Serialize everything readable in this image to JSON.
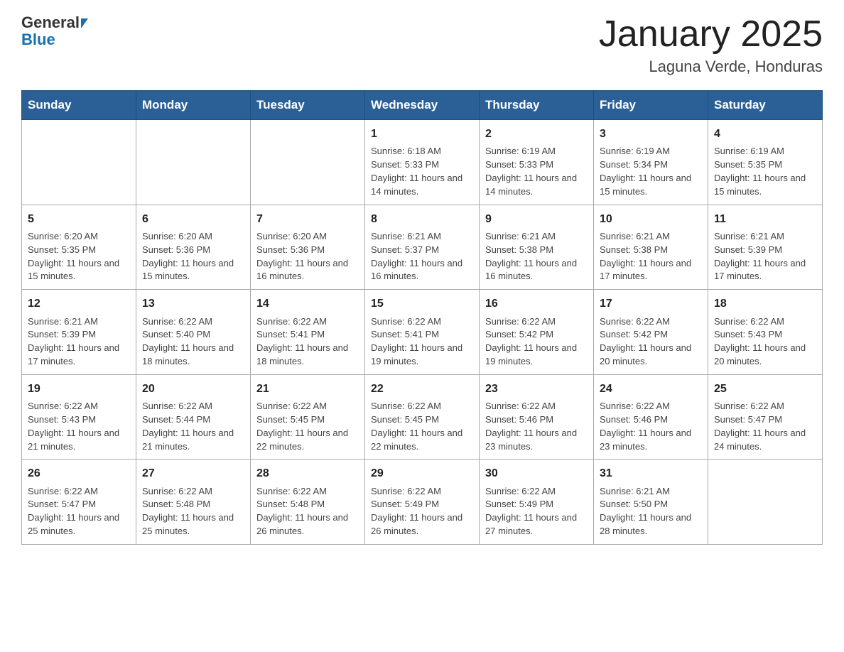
{
  "header": {
    "logo_general": "General",
    "logo_blue": "Blue",
    "month_title": "January 2025",
    "location": "Laguna Verde, Honduras"
  },
  "days_of_week": [
    "Sunday",
    "Monday",
    "Tuesday",
    "Wednesday",
    "Thursday",
    "Friday",
    "Saturday"
  ],
  "weeks": [
    [
      {
        "date": "",
        "info": ""
      },
      {
        "date": "",
        "info": ""
      },
      {
        "date": "",
        "info": ""
      },
      {
        "date": "1",
        "info": "Sunrise: 6:18 AM\nSunset: 5:33 PM\nDaylight: 11 hours and 14 minutes."
      },
      {
        "date": "2",
        "info": "Sunrise: 6:19 AM\nSunset: 5:33 PM\nDaylight: 11 hours and 14 minutes."
      },
      {
        "date": "3",
        "info": "Sunrise: 6:19 AM\nSunset: 5:34 PM\nDaylight: 11 hours and 15 minutes."
      },
      {
        "date": "4",
        "info": "Sunrise: 6:19 AM\nSunset: 5:35 PM\nDaylight: 11 hours and 15 minutes."
      }
    ],
    [
      {
        "date": "5",
        "info": "Sunrise: 6:20 AM\nSunset: 5:35 PM\nDaylight: 11 hours and 15 minutes."
      },
      {
        "date": "6",
        "info": "Sunrise: 6:20 AM\nSunset: 5:36 PM\nDaylight: 11 hours and 15 minutes."
      },
      {
        "date": "7",
        "info": "Sunrise: 6:20 AM\nSunset: 5:36 PM\nDaylight: 11 hours and 16 minutes."
      },
      {
        "date": "8",
        "info": "Sunrise: 6:21 AM\nSunset: 5:37 PM\nDaylight: 11 hours and 16 minutes."
      },
      {
        "date": "9",
        "info": "Sunrise: 6:21 AM\nSunset: 5:38 PM\nDaylight: 11 hours and 16 minutes."
      },
      {
        "date": "10",
        "info": "Sunrise: 6:21 AM\nSunset: 5:38 PM\nDaylight: 11 hours and 17 minutes."
      },
      {
        "date": "11",
        "info": "Sunrise: 6:21 AM\nSunset: 5:39 PM\nDaylight: 11 hours and 17 minutes."
      }
    ],
    [
      {
        "date": "12",
        "info": "Sunrise: 6:21 AM\nSunset: 5:39 PM\nDaylight: 11 hours and 17 minutes."
      },
      {
        "date": "13",
        "info": "Sunrise: 6:22 AM\nSunset: 5:40 PM\nDaylight: 11 hours and 18 minutes."
      },
      {
        "date": "14",
        "info": "Sunrise: 6:22 AM\nSunset: 5:41 PM\nDaylight: 11 hours and 18 minutes."
      },
      {
        "date": "15",
        "info": "Sunrise: 6:22 AM\nSunset: 5:41 PM\nDaylight: 11 hours and 19 minutes."
      },
      {
        "date": "16",
        "info": "Sunrise: 6:22 AM\nSunset: 5:42 PM\nDaylight: 11 hours and 19 minutes."
      },
      {
        "date": "17",
        "info": "Sunrise: 6:22 AM\nSunset: 5:42 PM\nDaylight: 11 hours and 20 minutes."
      },
      {
        "date": "18",
        "info": "Sunrise: 6:22 AM\nSunset: 5:43 PM\nDaylight: 11 hours and 20 minutes."
      }
    ],
    [
      {
        "date": "19",
        "info": "Sunrise: 6:22 AM\nSunset: 5:43 PM\nDaylight: 11 hours and 21 minutes."
      },
      {
        "date": "20",
        "info": "Sunrise: 6:22 AM\nSunset: 5:44 PM\nDaylight: 11 hours and 21 minutes."
      },
      {
        "date": "21",
        "info": "Sunrise: 6:22 AM\nSunset: 5:45 PM\nDaylight: 11 hours and 22 minutes."
      },
      {
        "date": "22",
        "info": "Sunrise: 6:22 AM\nSunset: 5:45 PM\nDaylight: 11 hours and 22 minutes."
      },
      {
        "date": "23",
        "info": "Sunrise: 6:22 AM\nSunset: 5:46 PM\nDaylight: 11 hours and 23 minutes."
      },
      {
        "date": "24",
        "info": "Sunrise: 6:22 AM\nSunset: 5:46 PM\nDaylight: 11 hours and 23 minutes."
      },
      {
        "date": "25",
        "info": "Sunrise: 6:22 AM\nSunset: 5:47 PM\nDaylight: 11 hours and 24 minutes."
      }
    ],
    [
      {
        "date": "26",
        "info": "Sunrise: 6:22 AM\nSunset: 5:47 PM\nDaylight: 11 hours and 25 minutes."
      },
      {
        "date": "27",
        "info": "Sunrise: 6:22 AM\nSunset: 5:48 PM\nDaylight: 11 hours and 25 minutes."
      },
      {
        "date": "28",
        "info": "Sunrise: 6:22 AM\nSunset: 5:48 PM\nDaylight: 11 hours and 26 minutes."
      },
      {
        "date": "29",
        "info": "Sunrise: 6:22 AM\nSunset: 5:49 PM\nDaylight: 11 hours and 26 minutes."
      },
      {
        "date": "30",
        "info": "Sunrise: 6:22 AM\nSunset: 5:49 PM\nDaylight: 11 hours and 27 minutes."
      },
      {
        "date": "31",
        "info": "Sunrise: 6:21 AM\nSunset: 5:50 PM\nDaylight: 11 hours and 28 minutes."
      },
      {
        "date": "",
        "info": ""
      }
    ]
  ]
}
